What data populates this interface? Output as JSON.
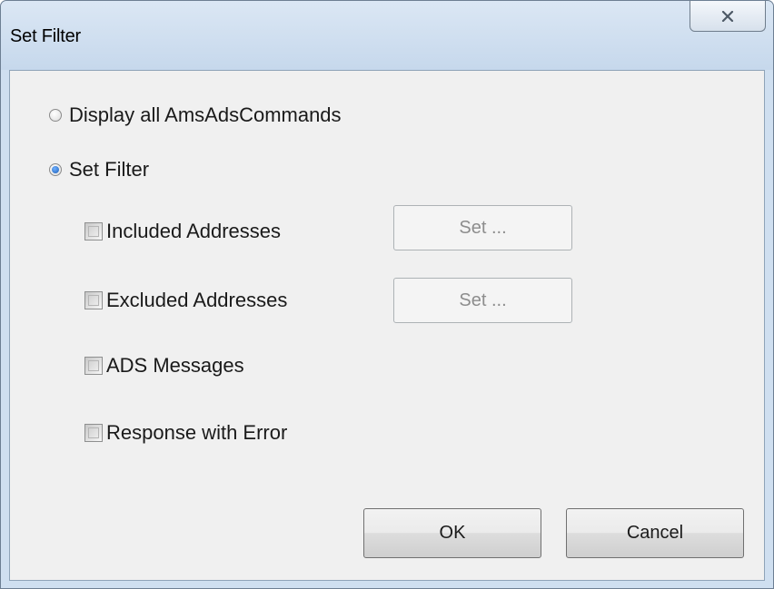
{
  "window": {
    "title": "Set Filter"
  },
  "titlebar": {
    "close_icon": "close-x-icon"
  },
  "filter_mode": {
    "options": [
      {
        "label": "Display all AmsAdsCommands",
        "checked": false
      },
      {
        "label": "Set Filter",
        "checked": true
      }
    ]
  },
  "filters": {
    "included": {
      "label": "Included Addresses",
      "checked": false,
      "button_label": "Set ...",
      "button_enabled": false
    },
    "excluded": {
      "label": "Excluded Addresses",
      "checked": false,
      "button_label": "Set ...",
      "button_enabled": false
    },
    "ads_messages": {
      "label": "ADS Messages",
      "checked": false
    },
    "response_error": {
      "label": "Response with Error",
      "checked": false
    }
  },
  "buttons": {
    "ok_label": "OK",
    "cancel_label": "Cancel"
  },
  "colors": {
    "title_bar": "#c6d8ec",
    "client_bg": "#f0f0f0",
    "radio_selected": "#1c5fb8"
  }
}
